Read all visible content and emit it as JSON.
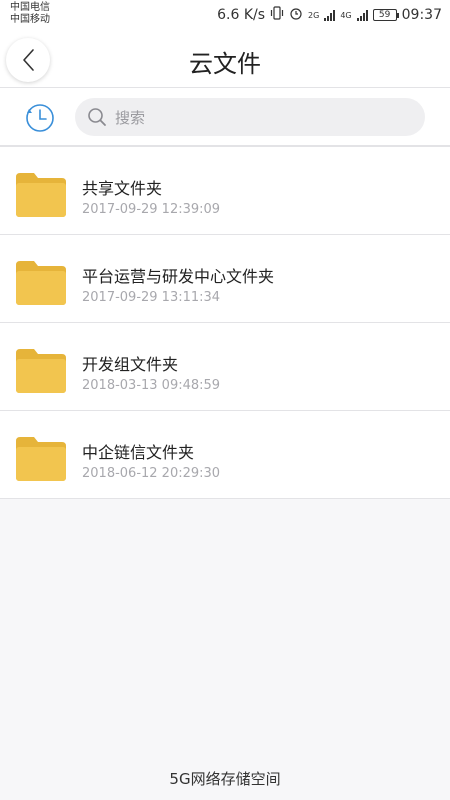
{
  "status": {
    "carrier1": "中国电信",
    "carrier2": "中国移动",
    "speed": "6.6 K/s",
    "net1": "2G",
    "net2": "4G",
    "battery": "59",
    "time": "09:37"
  },
  "header": {
    "title": "云文件"
  },
  "search": {
    "placeholder": "搜索"
  },
  "folders": [
    {
      "name": "共享文件夹",
      "time": "2017-09-29 12:39:09"
    },
    {
      "name": "平台运营与研发中心文件夹",
      "time": "2017-09-29 13:11:34"
    },
    {
      "name": "开发组文件夹",
      "time": "2018-03-13 09:48:59"
    },
    {
      "name": "中企链信文件夹",
      "time": "2018-06-12 20:29:30"
    }
  ],
  "footer": {
    "text": "5G网络存储空间"
  },
  "colors": {
    "folder": "#f2c54f",
    "folder_dark": "#e6b43a",
    "accent": "#3a8fd9"
  }
}
